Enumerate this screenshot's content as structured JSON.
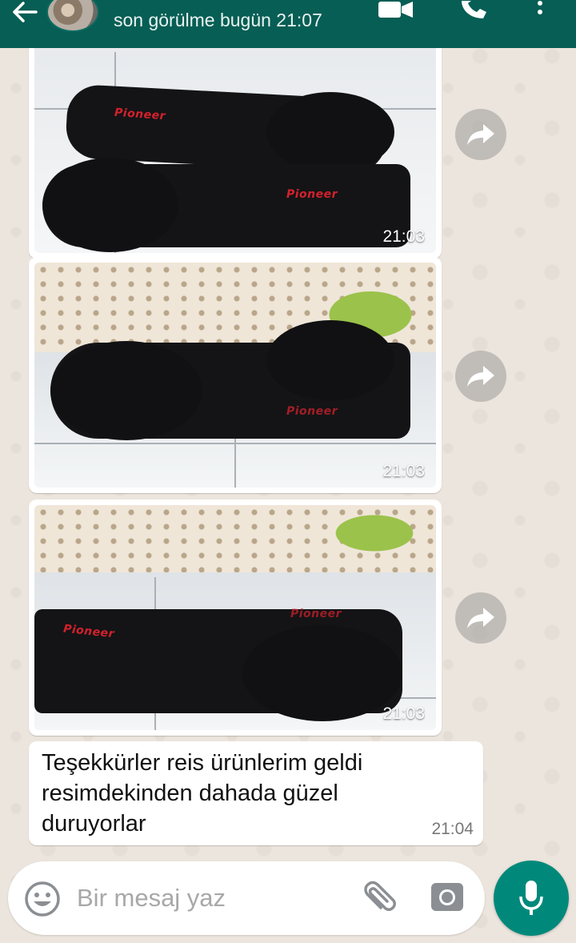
{
  "header": {
    "status": "son görülme bugün 21:07",
    "icons": [
      "back-arrow-icon",
      "video-call-icon",
      "phone-call-icon",
      "more-options-icon"
    ],
    "color": "#075e54"
  },
  "messages": [
    {
      "type": "image",
      "time": "21:03",
      "brand": "Pioneer"
    },
    {
      "type": "image",
      "time": "21:03",
      "brand": "Pioneer"
    },
    {
      "type": "image",
      "time": "21:03",
      "brand": "Pioneer"
    },
    {
      "type": "text",
      "text": "Teşekkürler reis ürünlerim geldi resimdekinden dahada güzel duruyorlar",
      "time": "21:04"
    }
  ],
  "composer": {
    "placeholder": "Bir mesaj yaz",
    "icons": [
      "emoji-icon",
      "attach-icon",
      "camera-icon",
      "microphone-icon"
    ],
    "mic_color": "#00897b"
  }
}
